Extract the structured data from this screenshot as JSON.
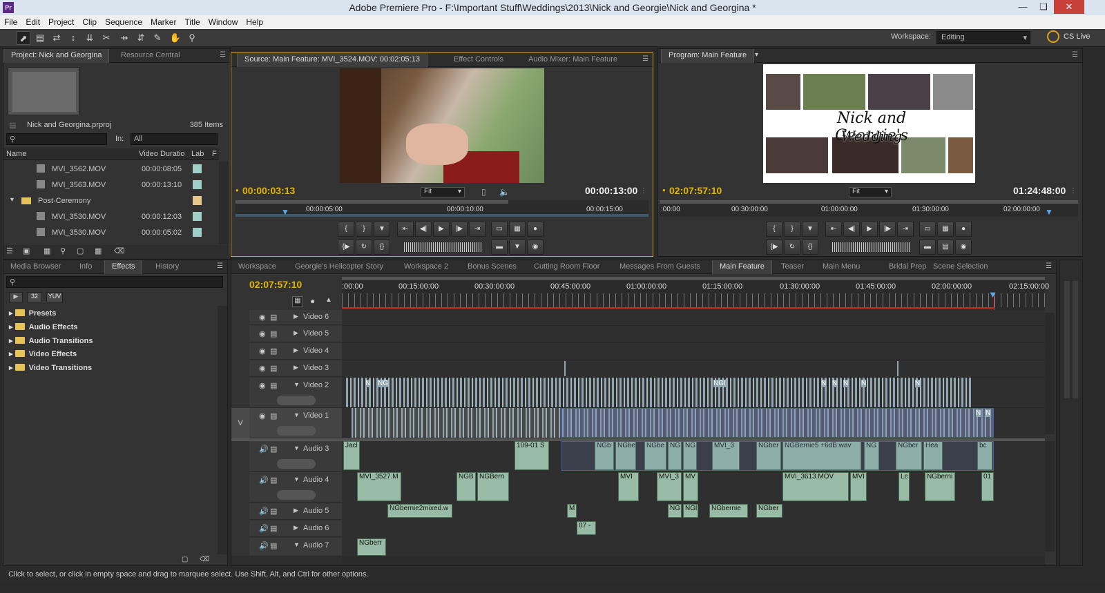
{
  "window": {
    "title": "Adobe Premiere Pro - F:\\Important Stuff\\Weddings\\2013\\Nick and Georgie\\Nick and Georgina *",
    "app_icon": "Pr"
  },
  "menu": [
    "File",
    "Edit",
    "Project",
    "Clip",
    "Sequence",
    "Marker",
    "Title",
    "Window",
    "Help"
  ],
  "workspace": {
    "label": "Workspace:",
    "value": "Editing",
    "cslive": "CS Live"
  },
  "project": {
    "tabs": [
      "Project: Nick and Georgina",
      "Resource Central"
    ],
    "filename": "Nick and Georgina.prproj",
    "item_count": "385 Items",
    "in_label": "In:",
    "in_value": "All",
    "columns": [
      "Name",
      "Video Duratio",
      "Lab",
      "F"
    ],
    "rows": [
      {
        "name": "MVI_3562.MOV",
        "duration": "00:00:08:05",
        "type": "clip"
      },
      {
        "name": "MVI_3563.MOV",
        "duration": "00:00:13:10",
        "type": "clip"
      },
      {
        "name": "Post-Ceremony",
        "duration": "",
        "type": "folder"
      },
      {
        "name": "MVI_3530.MOV",
        "duration": "00:00:12:03",
        "type": "clip"
      },
      {
        "name": "MVI_3530.MOV",
        "duration": "00:00:05:02",
        "type": "clip"
      }
    ]
  },
  "source": {
    "tabs": [
      "Source: Main Feature: MVI_3524.MOV: 00:02:05:13",
      "Effect Controls",
      "Audio Mixer: Main Feature"
    ],
    "current_tc": "00:00:03:13",
    "duration_tc": "00:00:13:00",
    "fit": "Fit",
    "ruler": [
      "00:00:05:00",
      "00:00:10:00",
      "00:00:15:00"
    ]
  },
  "program": {
    "tab": "Program: Main Feature",
    "current_tc": "02:07:57:10",
    "duration_tc": "01:24:48:00",
    "fit": "Fit",
    "ruler": [
      ":00:00",
      "00:30:00:00",
      "01:00:00:00",
      "01:30:00:00",
      "02:00:00:00"
    ],
    "title_line1": "Nick and Georgie's",
    "title_line2": "Wedding"
  },
  "effects": {
    "tabs": [
      "Media Browser",
      "Info",
      "Effects",
      "History"
    ],
    "buttons": [
      "32",
      "YUV"
    ],
    "items": [
      "Presets",
      "Audio Effects",
      "Audio Transitions",
      "Video Effects",
      "Video Transitions"
    ]
  },
  "timeline": {
    "tabs": [
      "Workspace",
      "Georgie's Helicopter Story",
      "Workspace 2",
      "Bonus Scenes",
      "Cutting Room Floor",
      "Messages From Guests",
      "Main Feature",
      "Teaser",
      "Main Menu",
      "Bridal Prep",
      "Scene Selection"
    ],
    "current_tc": "02:07:57:10",
    "ruler": [
      ":00:00",
      "00:15:00:00",
      "00:30:00:00",
      "00:45:00:00",
      "01:00:00:00",
      "01:15:00:00",
      "01:30:00:00",
      "01:45:00:00",
      "02:00:00:00",
      "02:15:00:00"
    ],
    "v_label": "V",
    "video_tracks": [
      "Video 6",
      "Video 5",
      "Video 4",
      "Video 3",
      "Video 2",
      "Video 1"
    ],
    "audio_tracks": [
      "Audio 3",
      "Audio 4",
      "Audio 5",
      "Audio 6",
      "Audio 7"
    ],
    "clip_labels": {
      "v2": [
        "N",
        "NG",
        "NGI",
        "N",
        "N",
        "N",
        "N",
        "N"
      ],
      "v1": [
        "N",
        "N"
      ],
      "a3": [
        "Jacl",
        "109-01 S",
        "NGb",
        "NGbe",
        "NGbe",
        "NG",
        "NG",
        "MVI_3",
        "NGber",
        "NGBernie5 +6dB.wav",
        "NG",
        "NGber",
        "Hea",
        "bc"
      ],
      "a4": [
        "MVI_3527.M",
        "NGB",
        "NGBern",
        "MVI",
        "MVI_3",
        "MV",
        "MVI_3613.MOV",
        "MVI",
        "Lc",
        "NGberni",
        "01"
      ],
      "a5": [
        "NGbernie2mixed.w",
        "NG",
        "NGl",
        "NGbernie",
        "NGber",
        "M"
      ],
      "a6": [
        "07 -"
      ],
      "a7": [
        "NGberr"
      ]
    }
  },
  "status": "Click to select, or click in empty space and drag to marquee select. Use Shift, Alt, and Ctrl for other options."
}
